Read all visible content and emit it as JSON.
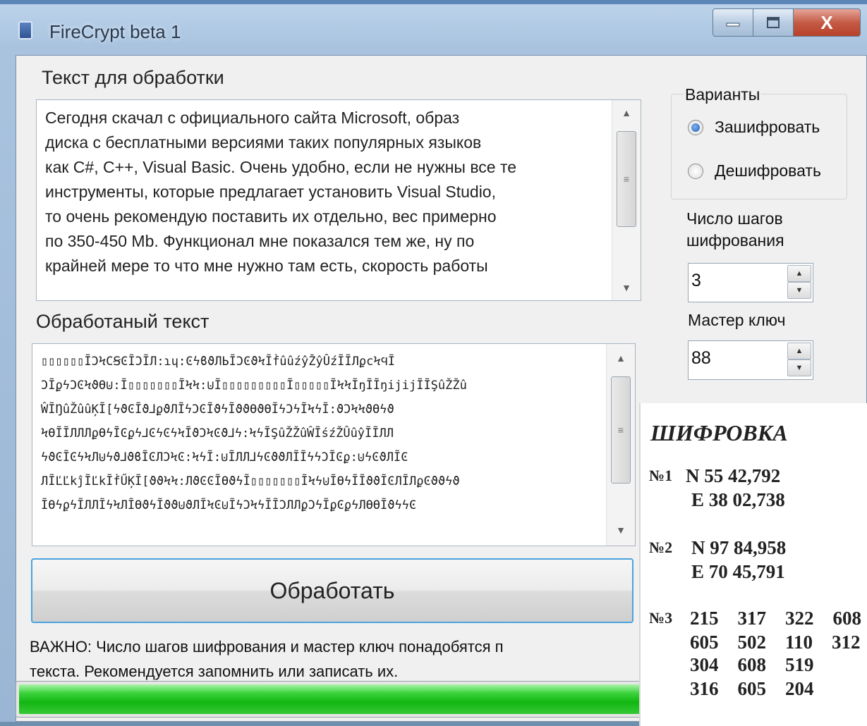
{
  "window": {
    "title": "FireCrypt beta 1",
    "close_glyph": "X"
  },
  "input": {
    "label": "Текст для обработки",
    "text": "Сегодня скачал с официального сайта Microsoft, образ\nдиска с бесплатными версиями таких популярных языков\nкак C#, C++, Visual Basic. Очень удобно, если не нужны все те\nинструменты, которые предлагает установить Visual Studio,\nто очень рекомендую поставить их отдельно, вес примерно\nпо 350-450 Mb. Функционал мне показался тем же, ну по\nкрайней мере то что мне нужно там есть, скорость работы"
  },
  "output": {
    "label": "Обработаный текст",
    "text": "▯▯▯▯▯▯ĨϽϞϹꞨϾĨϽĨЛ:ɿɥ:ϾϟϐϑЛЬĨϽϾϑϞĨḟûûźŷŽŷÛźĨĨЛϼϲϞϤĨ\nϽĨϼϟϽϾϞϑϴ⊍:Ĩ▯▯▯▯▯▯▯ĨϞϞ:⊍Ĩ▯▯▯▯▯▯▯▯▯Ĩ▯▯▯▯▯ĨϞϞĨŋĨĨŋijijĨĨŞûŽŽû\nŴĨŊûŽûûĶĨ[ϟϑϾĨϑ⅃ϼϑЛĨϟϽϾĨϑϟĨϑϑϴϑϴĨϟϽϟĨϞϟĨ:ϑϽϞϞϑϴϟϑ\nϞϴĨĨЛЛЛϼϴϟĨϾϼϟ⅃ϾϟϾϟϞĨϑϽϞϾϑ⅃ϟ:ϞϟĨŞûŽŽûŴĨśźŽÛûŷĨĨЛЛ\nϟϑϾĨϾϟϞЛ⊍ϟϑ⅃ϑϐĨϾЛϽϞϾ:ϞϟĨ:⊍ĨЛЛ⅃ϟϾϑϑЛĨĨϟϟϽĨϾϼ:⊍ϟϾϑЛĨϾ\nЛĨĽĽkĵĨĽkĨḟŰĶĨ[ϑϑϞϞ:ЛϑϾϾĨϴϑϟĨ▯▯▯▯▯▯▯ĨϞϟ⊍ĨϴϟĨĨϑϑĨϾЛĨЛϼϾϑϑϟϑ\nĨϴϟϼϟĨЛЛĨϟϞЛĨϴϑϟĨϑϑ⊍ϑЛĨϞϾ⊍ĨϟϽϞϟĨĨϽЛЛϼϽϟĨϼϾϼϟЛϴϴĨϑϟϟϾ"
  },
  "options": {
    "group_label": "Варианты",
    "encrypt_label": "Зашифровать",
    "decrypt_label": "Дешифровать",
    "selected": "encrypt",
    "steps_label": "Число шагов шифрования",
    "steps_value": "3",
    "key_label": "Мастер ключ",
    "key_value": "88"
  },
  "process_button": "Обработать",
  "note": "ВАЖНО: Число шагов шифрования и мастер ключ понадобятся п\nтекста. Рекомендуется запомнить или записать их.",
  "progress": {
    "percent": 100,
    "color": "#1fbf1f"
  },
  "overlay": {
    "heading": "ШИФРОВКА",
    "n1_label": "№1",
    "n1_line1": "N 55 42,792",
    "n1_line2": "E 38 02,738",
    "n2_label": "№2",
    "n2_line1": "N 97 84,958",
    "n2_line2": "E 70 45,791",
    "n3_label": "№3",
    "n3_row1": "215    317    322    608",
    "n3_row2": "605    502    110    312",
    "n3_row3": "304    608    519",
    "n3_row4": "316    605    204"
  }
}
